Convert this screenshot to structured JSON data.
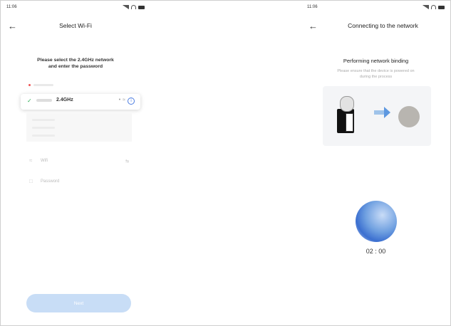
{
  "left_screen": {
    "status_time": "11:06",
    "title": "Select Wi-Fi",
    "prompt_line1": "Please select the 2.4GHz network",
    "prompt_line2": "and enter the password",
    "selected_network_label": "2.4GHz",
    "wifi_placeholder": "Wifi",
    "password_placeholder": "Password",
    "next_label": "Next"
  },
  "right_screen": {
    "status_time": "11:06",
    "title": "Connecting to the network",
    "binding_title": "Performing network binding",
    "binding_sub_line1": "Please ensure that the device is powered on",
    "binding_sub_line2": "during the process",
    "countdown": "02 : 00"
  },
  "colors": {
    "accent": "#4a7be0",
    "check": "#2fae58",
    "button_disabled": "#c8ddf6"
  }
}
